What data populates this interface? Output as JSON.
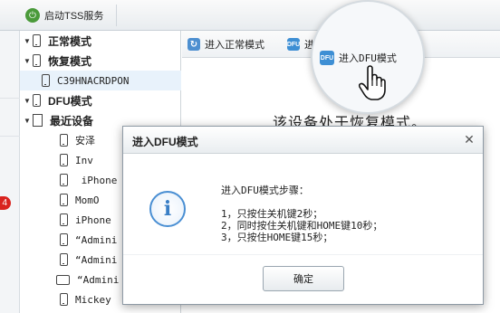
{
  "toolbar": {
    "tss_label": "启动TSS服务",
    "tss_icon": "power-icon"
  },
  "left_edge": {
    "badge": "4"
  },
  "tree": {
    "items": [
      {
        "label": "正常模式",
        "type": "group",
        "expanded": true,
        "icon": "phone-icon"
      },
      {
        "label": "恢复模式",
        "type": "group",
        "expanded": true,
        "icon": "recovery-icon"
      },
      {
        "label": "C39HNACRDPON",
        "type": "device",
        "selected": true,
        "icon": "phone-icon"
      },
      {
        "label": "DFU模式",
        "type": "group",
        "expanded": true,
        "icon": "phone-icon"
      },
      {
        "label": "最近设备",
        "type": "group",
        "expanded": true,
        "icon": "recent-icon"
      },
      {
        "label": "安泽",
        "type": "device",
        "icon": "phone-icon"
      },
      {
        "label": "Inv",
        "type": "device",
        "icon": "phone-icon"
      },
      {
        "label": " iPhone",
        "type": "device",
        "icon": "phone-icon"
      },
      {
        "label": "MomO",
        "type": "device",
        "icon": "phone-icon"
      },
      {
        "label": "iPhone",
        "type": "device",
        "icon": "phone-icon"
      },
      {
        "label": "“Admini",
        "type": "device",
        "icon": "phone-icon"
      },
      {
        "label": "“Admini",
        "type": "device",
        "icon": "phone-icon"
      },
      {
        "label": "“Admini",
        "type": "device",
        "icon": "ipad-icon"
      },
      {
        "label": "Mickey",
        "type": "device",
        "icon": "phone-icon"
      }
    ]
  },
  "mode_bar": {
    "normal_label": "进入正常模式",
    "dfu_partial": "进",
    "dfu_label": "进入DFU模式"
  },
  "main": {
    "status": "该设备处于恢复模式。"
  },
  "dialog": {
    "title": "进入DFU模式",
    "heading": "进入DFU模式步骤：",
    "steps": [
      "1，只按住关机键2秒；",
      "2，同时按住关机键和HOME键10秒；",
      "3，只按住HOME键15秒；"
    ],
    "ok_label": "确定",
    "icon": "info-icon"
  },
  "colors": {
    "accent": "#3e8fd4",
    "badge": "#d9231f",
    "selected_row": "#e8f2fb"
  }
}
